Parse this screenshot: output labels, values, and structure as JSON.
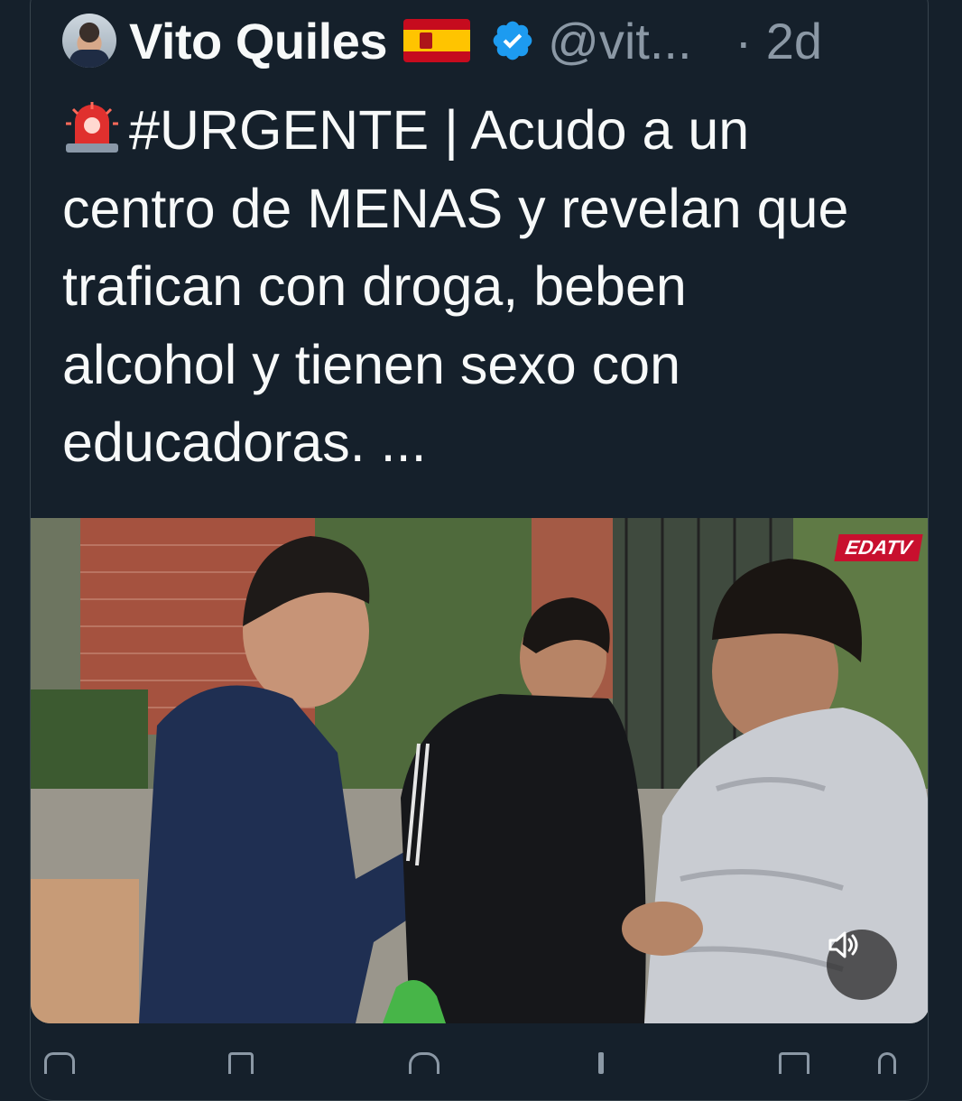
{
  "tweet": {
    "author_name": "Vito Quiles",
    "handle": "@vit...",
    "time": "· 2d",
    "flag_emoji": "spain-flag",
    "text_line1": "#URGENTE | Acudo a un",
    "text_rest": "centro de MENAS y revelan que\ntrafican con droga, beben\nalcohol y tienen sexo con\neducadoras. ...",
    "media": {
      "watermark": "EDATV",
      "mute_icon": "volume-muted-icon"
    }
  },
  "colors": {
    "background": "#15202b",
    "border": "#38444d",
    "secondary_text": "#8b98a5",
    "verified": "#1d9bf0",
    "watermark_red": "#c8102e"
  }
}
